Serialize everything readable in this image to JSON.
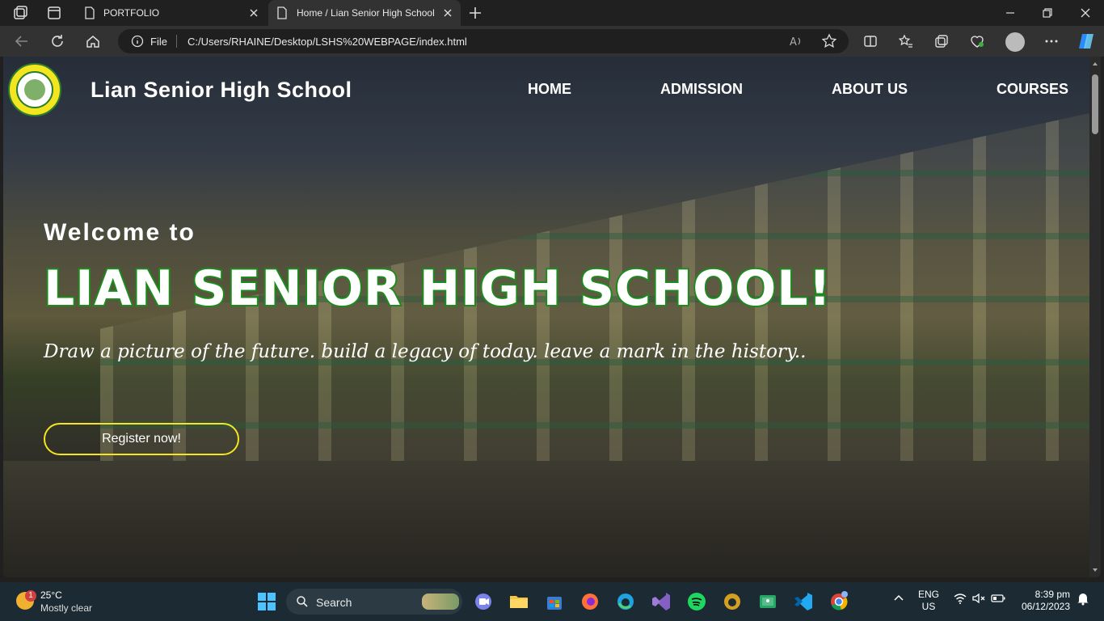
{
  "browser": {
    "tabs": [
      {
        "title": "PORTFOLIO",
        "active": false
      },
      {
        "title": "Home / Lian Senior High School",
        "active": true
      }
    ],
    "address": {
      "scheme": "File",
      "url": "C:/Users/RHAINE/Desktop/LSHS%20WEBPAGE/index.html"
    }
  },
  "site": {
    "title": "Lian Senior High School",
    "menu": [
      "HOME",
      "ADMISSION",
      "ABOUT US",
      "COURSES"
    ],
    "welcome": "Welcome to",
    "headline": "LIAN SENIOR HIGH SCHOOL!",
    "tagline": "Draw a picture of the future. build a legacy of today. leave a mark in the history..",
    "register_label": "Register now!"
  },
  "taskbar": {
    "weather": {
      "badge": "1",
      "temp": "25°C",
      "condition": "Mostly clear"
    },
    "search_label": "Search",
    "lang": {
      "line1": "ENG",
      "line2": "US"
    },
    "clock": {
      "time": "8:39 pm",
      "date": "06/12/2023"
    }
  },
  "colors": {
    "accent_yellow": "#f3e620",
    "headline_green": "#1c8a1c"
  }
}
